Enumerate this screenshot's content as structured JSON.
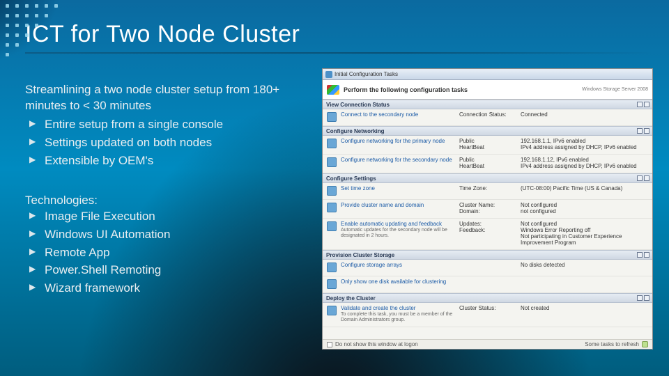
{
  "slide": {
    "title": "ICT for Two Node Cluster",
    "lead": "Streamlining a two node cluster setup from 180+ minutes to < 30 minutes",
    "bullets1": [
      "Entire setup from a single console",
      "Settings updated on both nodes",
      "Extensible by OEM's"
    ],
    "tech_head": "Technologies:",
    "bullets2": [
      "Image File Execution",
      "Windows UI Automation",
      "Remote App",
      "Power.Shell Remoting",
      "Wizard framework"
    ]
  },
  "shot": {
    "window_title": "Initial Configuration Tasks",
    "banner": "Perform the following configuration tasks",
    "logo": "Windows Storage Server 2008",
    "sections": [
      {
        "title": "View Connection Status",
        "rows": [
          {
            "link": "Connect to the secondary node",
            "sub": "",
            "k": "Connection Status:",
            "v": "Connected"
          }
        ]
      },
      {
        "title": "Configure Networking",
        "rows": [
          {
            "link": "Configure networking for the primary node",
            "sub": "",
            "k": "Public\nHeartBeat",
            "v": "192.168.1.1, IPv6 enabled\nIPv4 address assigned by DHCP, IPv6 enabled"
          },
          {
            "link": "Configure networking for the secondary node",
            "sub": "",
            "k": "Public\nHeartBeat",
            "v": "192.168.1.12, IPv6 enabled\nIPv4 address assigned by DHCP, IPv6 enabled"
          }
        ]
      },
      {
        "title": "Configure Settings",
        "rows": [
          {
            "link": "Set time zone",
            "sub": "",
            "k": "Time Zone:",
            "v": "(UTC-08:00) Pacific Time (US & Canada)"
          },
          {
            "link": "Provide cluster name and domain",
            "sub": "",
            "k": "Cluster Name:\nDomain:",
            "v": "Not configured\nnot configured"
          },
          {
            "link": "Enable automatic updating and feedback",
            "sub": "Automatic updates for the secondary node will be designated in 2 hours.",
            "k": "Updates:\nFeedback:",
            "v": "Not configured\nWindows Error Reporting off\nNot participating in Customer Experience Improvement Program"
          }
        ]
      },
      {
        "title": "Provision Cluster Storage",
        "rows": [
          {
            "link": "Configure storage arrays",
            "sub": "",
            "k": "",
            "v": "No disks detected"
          },
          {
            "link": "Only show one disk available for clustering",
            "sub": "",
            "k": "",
            "v": ""
          }
        ]
      },
      {
        "title": "Deploy the Cluster",
        "rows": [
          {
            "link": "Validate and create the cluster",
            "sub": "To complete this task, you must be a member of the Domain Administrators group.",
            "k": "Cluster Status:",
            "v": "Not created"
          }
        ]
      }
    ],
    "footer_left": "Do not show this window at logon",
    "footer_right": "Some tasks to refresh"
  }
}
